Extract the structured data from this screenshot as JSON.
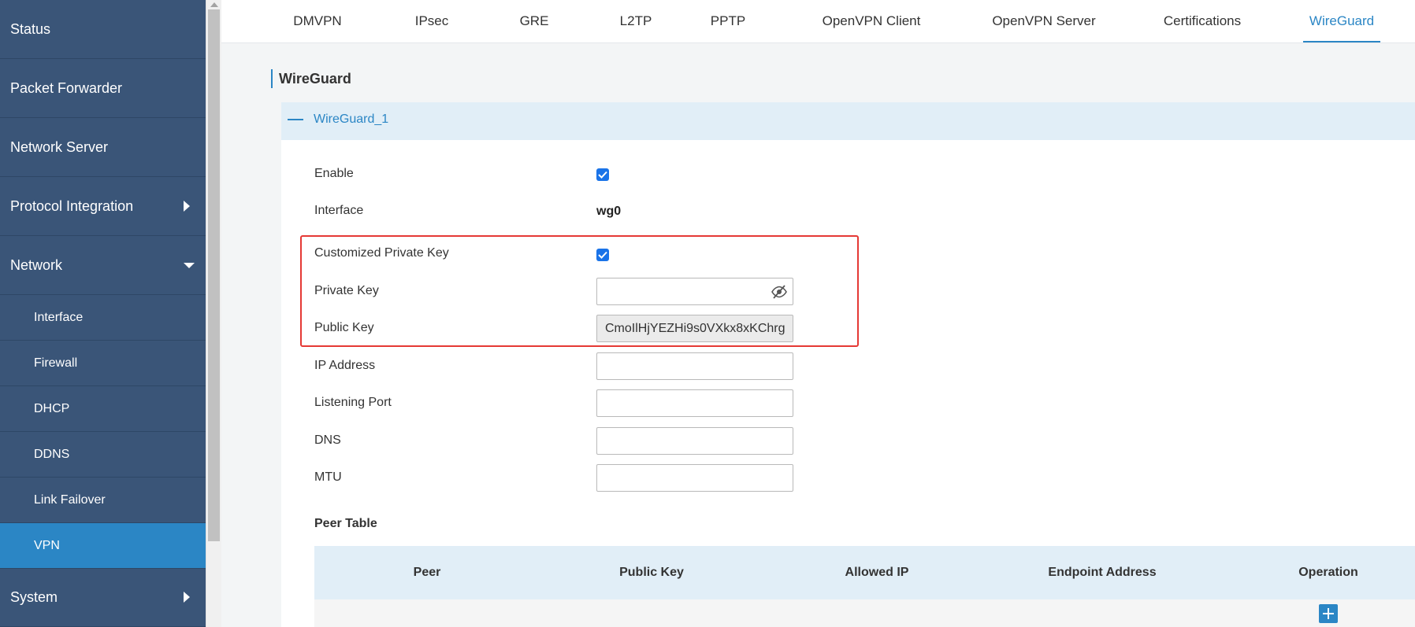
{
  "sidebar": {
    "items": [
      {
        "label": "Status"
      },
      {
        "label": "Packet Forwarder"
      },
      {
        "label": "Network Server"
      },
      {
        "label": "Protocol Integration"
      },
      {
        "label": "Network"
      },
      {
        "label": "Interface"
      },
      {
        "label": "Firewall"
      },
      {
        "label": "DHCP"
      },
      {
        "label": "DDNS"
      },
      {
        "label": "Link Failover"
      },
      {
        "label": "VPN"
      },
      {
        "label": "System"
      }
    ],
    "active": "VPN"
  },
  "tabs": [
    {
      "label": "DMVPN"
    },
    {
      "label": "IPsec"
    },
    {
      "label": "GRE"
    },
    {
      "label": "L2TP"
    },
    {
      "label": "PPTP"
    },
    {
      "label": "OpenVPN Client"
    },
    {
      "label": "OpenVPN Server"
    },
    {
      "label": "Certifications"
    },
    {
      "label": "WireGuard"
    }
  ],
  "active_tab": "WireGuard",
  "section_title": "WireGuard",
  "panel": {
    "title": "WireGuard_1",
    "fields": {
      "enable": {
        "label": "Enable",
        "checked": true
      },
      "interface": {
        "label": "Interface",
        "value": "wg0"
      },
      "custom_key": {
        "label": "Customized Private Key",
        "checked": true
      },
      "private_key": {
        "label": "Private Key",
        "value": ""
      },
      "public_key": {
        "label": "Public Key",
        "value": "CmoIlHjYEZHi9s0VXkx8xKChrg"
      },
      "ip_address": {
        "label": "IP Address",
        "value": ""
      },
      "listening_port": {
        "label": "Listening Port",
        "value": ""
      },
      "dns": {
        "label": "DNS",
        "value": ""
      },
      "mtu": {
        "label": "MTU",
        "value": ""
      }
    }
  },
  "peer_table": {
    "title": "Peer Table",
    "columns": [
      "Peer",
      "Public Key",
      "Allowed IP",
      "Endpoint Address",
      "Operation"
    ]
  },
  "colors": {
    "sidebar_bg": "#3a5578",
    "accent": "#2b86c5",
    "highlight": "#e53935",
    "checkbox": "#1a73e8"
  },
  "icons": {
    "collapse": "minus-icon",
    "private_key_toggle": "eye-slash-icon",
    "add_peer": "plus-icon"
  }
}
